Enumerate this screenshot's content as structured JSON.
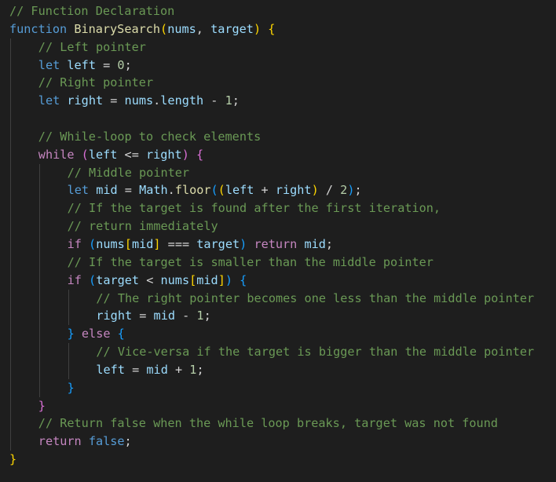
{
  "editor": {
    "language": "javascript",
    "theme_colors": {
      "background": "#1e1e1e",
      "comment": "#6a9955",
      "keyword": "#569cd6",
      "control": "#c586c0",
      "function": "#dcdcaa",
      "variable": "#9cdcfe",
      "number": "#b5cea8",
      "bracket_level_1": "#ffd700",
      "bracket_level_2": "#da70d6",
      "bracket_level_3": "#179fff"
    },
    "lines": [
      {
        "indent": 0,
        "tokens": [
          {
            "t": "// Function Declaration",
            "c": "comment"
          }
        ]
      },
      {
        "indent": 0,
        "tokens": [
          {
            "t": "function",
            "c": "keyword"
          },
          {
            "t": " ",
            "c": "plain"
          },
          {
            "t": "BinarySearch",
            "c": "func"
          },
          {
            "t": "(",
            "c": "b1"
          },
          {
            "t": "nums",
            "c": "var"
          },
          {
            "t": ", ",
            "c": "plain"
          },
          {
            "t": "target",
            "c": "var"
          },
          {
            "t": ")",
            "c": "b1"
          },
          {
            "t": " ",
            "c": "plain"
          },
          {
            "t": "{",
            "c": "b1"
          }
        ]
      },
      {
        "indent": 1,
        "tokens": [
          {
            "t": "// Left pointer",
            "c": "comment"
          }
        ]
      },
      {
        "indent": 1,
        "tokens": [
          {
            "t": "let",
            "c": "keyword"
          },
          {
            "t": " ",
            "c": "plain"
          },
          {
            "t": "left",
            "c": "var"
          },
          {
            "t": " = ",
            "c": "plain"
          },
          {
            "t": "0",
            "c": "num"
          },
          {
            "t": ";",
            "c": "plain"
          }
        ]
      },
      {
        "indent": 1,
        "tokens": [
          {
            "t": "// Right pointer",
            "c": "comment"
          }
        ]
      },
      {
        "indent": 1,
        "tokens": [
          {
            "t": "let",
            "c": "keyword"
          },
          {
            "t": " ",
            "c": "plain"
          },
          {
            "t": "right",
            "c": "var"
          },
          {
            "t": " = ",
            "c": "plain"
          },
          {
            "t": "nums",
            "c": "var"
          },
          {
            "t": ".",
            "c": "plain"
          },
          {
            "t": "length",
            "c": "var"
          },
          {
            "t": " - ",
            "c": "plain"
          },
          {
            "t": "1",
            "c": "num"
          },
          {
            "t": ";",
            "c": "plain"
          }
        ]
      },
      {
        "indent": 1,
        "tokens": []
      },
      {
        "indent": 1,
        "tokens": [
          {
            "t": "// While-loop to check elements",
            "c": "comment"
          }
        ]
      },
      {
        "indent": 1,
        "tokens": [
          {
            "t": "while",
            "c": "control"
          },
          {
            "t": " ",
            "c": "plain"
          },
          {
            "t": "(",
            "c": "b2"
          },
          {
            "t": "left",
            "c": "var"
          },
          {
            "t": " <= ",
            "c": "plain"
          },
          {
            "t": "right",
            "c": "var"
          },
          {
            "t": ")",
            "c": "b2"
          },
          {
            "t": " ",
            "c": "plain"
          },
          {
            "t": "{",
            "c": "b2"
          }
        ]
      },
      {
        "indent": 2,
        "tokens": [
          {
            "t": "// Middle pointer",
            "c": "comment"
          }
        ]
      },
      {
        "indent": 2,
        "tokens": [
          {
            "t": "let",
            "c": "keyword"
          },
          {
            "t": " ",
            "c": "plain"
          },
          {
            "t": "mid",
            "c": "var"
          },
          {
            "t": " = ",
            "c": "plain"
          },
          {
            "t": "Math",
            "c": "var"
          },
          {
            "t": ".",
            "c": "plain"
          },
          {
            "t": "floor",
            "c": "func"
          },
          {
            "t": "(",
            "c": "b3"
          },
          {
            "t": "(",
            "c": "b1"
          },
          {
            "t": "left",
            "c": "var"
          },
          {
            "t": " + ",
            "c": "plain"
          },
          {
            "t": "right",
            "c": "var"
          },
          {
            "t": ")",
            "c": "b1"
          },
          {
            "t": " / ",
            "c": "plain"
          },
          {
            "t": "2",
            "c": "num"
          },
          {
            "t": ")",
            "c": "b3"
          },
          {
            "t": ";",
            "c": "plain"
          }
        ]
      },
      {
        "indent": 2,
        "tokens": [
          {
            "t": "// If the target is found after the first iteration,",
            "c": "comment"
          }
        ]
      },
      {
        "indent": 2,
        "tokens": [
          {
            "t": "// return immediately",
            "c": "comment"
          }
        ]
      },
      {
        "indent": 2,
        "tokens": [
          {
            "t": "if",
            "c": "control"
          },
          {
            "t": " ",
            "c": "plain"
          },
          {
            "t": "(",
            "c": "b3"
          },
          {
            "t": "nums",
            "c": "var"
          },
          {
            "t": "[",
            "c": "b1"
          },
          {
            "t": "mid",
            "c": "var"
          },
          {
            "t": "]",
            "c": "b1"
          },
          {
            "t": " === ",
            "c": "plain"
          },
          {
            "t": "target",
            "c": "var"
          },
          {
            "t": ")",
            "c": "b3"
          },
          {
            "t": " ",
            "c": "plain"
          },
          {
            "t": "return",
            "c": "control"
          },
          {
            "t": " ",
            "c": "plain"
          },
          {
            "t": "mid",
            "c": "var"
          },
          {
            "t": ";",
            "c": "plain"
          }
        ]
      },
      {
        "indent": 2,
        "tokens": [
          {
            "t": "// If the target is smaller than the middle pointer",
            "c": "comment"
          }
        ]
      },
      {
        "indent": 2,
        "tokens": [
          {
            "t": "if",
            "c": "control"
          },
          {
            "t": " ",
            "c": "plain"
          },
          {
            "t": "(",
            "c": "b3"
          },
          {
            "t": "target",
            "c": "var"
          },
          {
            "t": " < ",
            "c": "plain"
          },
          {
            "t": "nums",
            "c": "var"
          },
          {
            "t": "[",
            "c": "b1"
          },
          {
            "t": "mid",
            "c": "var"
          },
          {
            "t": "]",
            "c": "b1"
          },
          {
            "t": ")",
            "c": "b3"
          },
          {
            "t": " ",
            "c": "plain"
          },
          {
            "t": "{",
            "c": "b3"
          }
        ]
      },
      {
        "indent": 3,
        "tokens": [
          {
            "t": "// The right pointer becomes one less than the middle pointer",
            "c": "comment"
          }
        ]
      },
      {
        "indent": 3,
        "tokens": [
          {
            "t": "right",
            "c": "var"
          },
          {
            "t": " = ",
            "c": "plain"
          },
          {
            "t": "mid",
            "c": "var"
          },
          {
            "t": " - ",
            "c": "plain"
          },
          {
            "t": "1",
            "c": "num"
          },
          {
            "t": ";",
            "c": "plain"
          }
        ]
      },
      {
        "indent": 2,
        "tokens": [
          {
            "t": "}",
            "c": "b3"
          },
          {
            "t": " ",
            "c": "plain"
          },
          {
            "t": "else",
            "c": "control"
          },
          {
            "t": " ",
            "c": "plain"
          },
          {
            "t": "{",
            "c": "b3"
          }
        ]
      },
      {
        "indent": 3,
        "tokens": [
          {
            "t": "// Vice-versa if the target is bigger than the middle pointer",
            "c": "comment"
          }
        ]
      },
      {
        "indent": 3,
        "tokens": [
          {
            "t": "left",
            "c": "var"
          },
          {
            "t": " = ",
            "c": "plain"
          },
          {
            "t": "mid",
            "c": "var"
          },
          {
            "t": " + ",
            "c": "plain"
          },
          {
            "t": "1",
            "c": "num"
          },
          {
            "t": ";",
            "c": "plain"
          }
        ]
      },
      {
        "indent": 2,
        "tokens": [
          {
            "t": "}",
            "c": "b3"
          }
        ]
      },
      {
        "indent": 1,
        "tokens": [
          {
            "t": "}",
            "c": "b2"
          }
        ]
      },
      {
        "indent": 1,
        "tokens": [
          {
            "t": "// Return false when the while loop breaks, target was not found",
            "c": "comment"
          }
        ]
      },
      {
        "indent": 1,
        "tokens": [
          {
            "t": "return",
            "c": "control"
          },
          {
            "t": " ",
            "c": "plain"
          },
          {
            "t": "false",
            "c": "keyword"
          },
          {
            "t": ";",
            "c": "plain"
          }
        ]
      },
      {
        "indent": 0,
        "tokens": [
          {
            "t": "}",
            "c": "b1"
          }
        ]
      }
    ]
  }
}
